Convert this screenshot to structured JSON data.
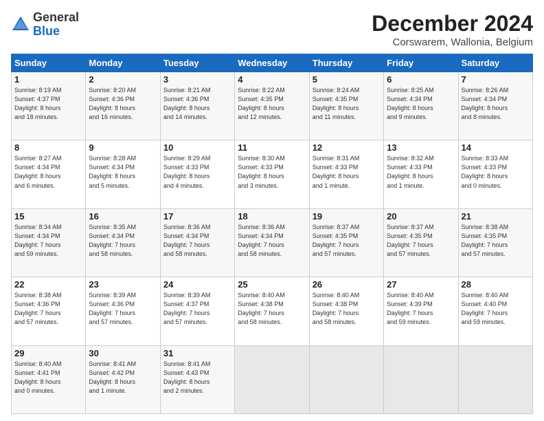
{
  "header": {
    "logo_general": "General",
    "logo_blue": "Blue",
    "title": "December 2024",
    "subtitle": "Corswarem, Wallonia, Belgium"
  },
  "days_of_week": [
    "Sunday",
    "Monday",
    "Tuesday",
    "Wednesday",
    "Thursday",
    "Friday",
    "Saturday"
  ],
  "weeks": [
    [
      {
        "day": 1,
        "info": "Sunrise: 8:19 AM\nSunset: 4:37 PM\nDaylight: 8 hours\nand 18 minutes."
      },
      {
        "day": 2,
        "info": "Sunrise: 8:20 AM\nSunset: 4:36 PM\nDaylight: 8 hours\nand 16 minutes."
      },
      {
        "day": 3,
        "info": "Sunrise: 8:21 AM\nSunset: 4:36 PM\nDaylight: 8 hours\nand 14 minutes."
      },
      {
        "day": 4,
        "info": "Sunrise: 8:22 AM\nSunset: 4:35 PM\nDaylight: 8 hours\nand 12 minutes."
      },
      {
        "day": 5,
        "info": "Sunrise: 8:24 AM\nSunset: 4:35 PM\nDaylight: 8 hours\nand 11 minutes."
      },
      {
        "day": 6,
        "info": "Sunrise: 8:25 AM\nSunset: 4:34 PM\nDaylight: 8 hours\nand 9 minutes."
      },
      {
        "day": 7,
        "info": "Sunrise: 8:26 AM\nSunset: 4:34 PM\nDaylight: 8 hours\nand 8 minutes."
      }
    ],
    [
      {
        "day": 8,
        "info": "Sunrise: 8:27 AM\nSunset: 4:34 PM\nDaylight: 8 hours\nand 6 minutes."
      },
      {
        "day": 9,
        "info": "Sunrise: 8:28 AM\nSunset: 4:34 PM\nDaylight: 8 hours\nand 5 minutes."
      },
      {
        "day": 10,
        "info": "Sunrise: 8:29 AM\nSunset: 4:33 PM\nDaylight: 8 hours\nand 4 minutes."
      },
      {
        "day": 11,
        "info": "Sunrise: 8:30 AM\nSunset: 4:33 PM\nDaylight: 8 hours\nand 3 minutes."
      },
      {
        "day": 12,
        "info": "Sunrise: 8:31 AM\nSunset: 4:33 PM\nDaylight: 8 hours\nand 1 minute."
      },
      {
        "day": 13,
        "info": "Sunrise: 8:32 AM\nSunset: 4:33 PM\nDaylight: 8 hours\nand 1 minute."
      },
      {
        "day": 14,
        "info": "Sunrise: 8:33 AM\nSunset: 4:33 PM\nDaylight: 8 hours\nand 0 minutes."
      }
    ],
    [
      {
        "day": 15,
        "info": "Sunrise: 8:34 AM\nSunset: 4:34 PM\nDaylight: 7 hours\nand 59 minutes."
      },
      {
        "day": 16,
        "info": "Sunrise: 8:35 AM\nSunset: 4:34 PM\nDaylight: 7 hours\nand 58 minutes."
      },
      {
        "day": 17,
        "info": "Sunrise: 8:36 AM\nSunset: 4:34 PM\nDaylight: 7 hours\nand 58 minutes."
      },
      {
        "day": 18,
        "info": "Sunrise: 8:36 AM\nSunset: 4:34 PM\nDaylight: 7 hours\nand 58 minutes."
      },
      {
        "day": 19,
        "info": "Sunrise: 8:37 AM\nSunset: 4:35 PM\nDaylight: 7 hours\nand 57 minutes."
      },
      {
        "day": 20,
        "info": "Sunrise: 8:37 AM\nSunset: 4:35 PM\nDaylight: 7 hours\nand 57 minutes."
      },
      {
        "day": 21,
        "info": "Sunrise: 8:38 AM\nSunset: 4:35 PM\nDaylight: 7 hours\nand 57 minutes."
      }
    ],
    [
      {
        "day": 22,
        "info": "Sunrise: 8:38 AM\nSunset: 4:36 PM\nDaylight: 7 hours\nand 57 minutes."
      },
      {
        "day": 23,
        "info": "Sunrise: 8:39 AM\nSunset: 4:36 PM\nDaylight: 7 hours\nand 57 minutes."
      },
      {
        "day": 24,
        "info": "Sunrise: 8:39 AM\nSunset: 4:37 PM\nDaylight: 7 hours\nand 57 minutes."
      },
      {
        "day": 25,
        "info": "Sunrise: 8:40 AM\nSunset: 4:38 PM\nDaylight: 7 hours\nand 58 minutes."
      },
      {
        "day": 26,
        "info": "Sunrise: 8:40 AM\nSunset: 4:38 PM\nDaylight: 7 hours\nand 58 minutes."
      },
      {
        "day": 27,
        "info": "Sunrise: 8:40 AM\nSunset: 4:39 PM\nDaylight: 7 hours\nand 59 minutes."
      },
      {
        "day": 28,
        "info": "Sunrise: 8:40 AM\nSunset: 4:40 PM\nDaylight: 7 hours\nand 59 minutes."
      }
    ],
    [
      {
        "day": 29,
        "info": "Sunrise: 8:40 AM\nSunset: 4:41 PM\nDaylight: 8 hours\nand 0 minutes."
      },
      {
        "day": 30,
        "info": "Sunrise: 8:41 AM\nSunset: 4:42 PM\nDaylight: 8 hours\nand 1 minute."
      },
      {
        "day": 31,
        "info": "Sunrise: 8:41 AM\nSunset: 4:43 PM\nDaylight: 8 hours\nand 2 minutes."
      },
      null,
      null,
      null,
      null
    ]
  ]
}
